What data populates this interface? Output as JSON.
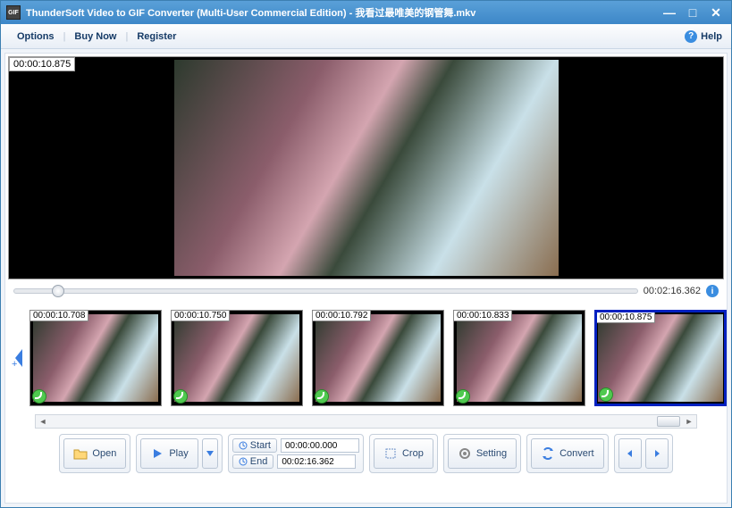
{
  "titlebar": {
    "app_name": "ThunderSoft Video to GIF Converter (Multi-User Commercial Edition)",
    "file_name": "我看过最唯美的钢管舞.mkv",
    "sep": " - "
  },
  "menu": {
    "options": "Options",
    "buy": "Buy Now",
    "register": "Register",
    "help": "Help"
  },
  "preview": {
    "timestamp": "00:00:10.875"
  },
  "slider": {
    "total_time": "00:02:16.362"
  },
  "thumbs": [
    {
      "ts": "00:00:10.708"
    },
    {
      "ts": "00:00:10.750"
    },
    {
      "ts": "00:00:10.792"
    },
    {
      "ts": "00:00:10.833"
    },
    {
      "ts": "00:00:10.875",
      "selected": true
    }
  ],
  "toolbar": {
    "open": "Open",
    "play": "Play",
    "start": "Start",
    "end": "End",
    "start_val": "00:00:00.000",
    "end_val": "00:02:16.362",
    "crop": "Crop",
    "setting": "Setting",
    "convert": "Convert"
  }
}
